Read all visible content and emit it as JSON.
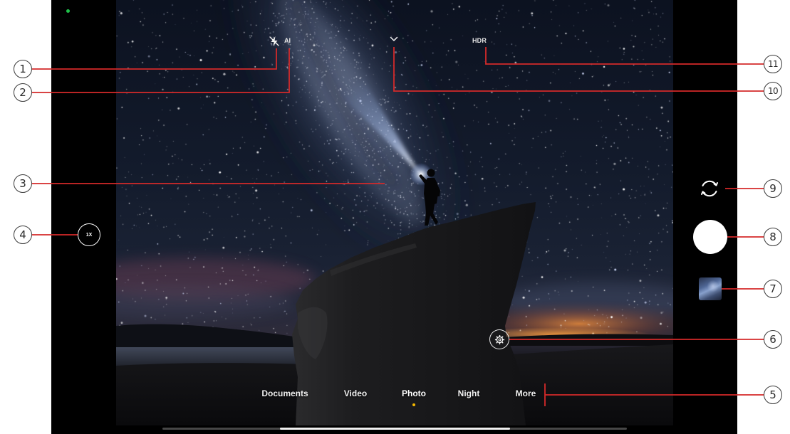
{
  "status": {
    "camera_indicator_color": "#1fc24a"
  },
  "top_bar": {
    "flash_icon": "flash-off-icon",
    "ai_label": "AI",
    "expand_icon": "chevron-down-icon",
    "hdr_label": "HDR"
  },
  "left_panel": {
    "zoom_label": "1X"
  },
  "right_panel": {
    "switch_camera_icon": "rotate-camera-icon"
  },
  "viewfinder": {
    "settings_icon": "settings-icon"
  },
  "modes": {
    "items": [
      {
        "label": "Documents",
        "active": false
      },
      {
        "label": "Video",
        "active": false
      },
      {
        "label": "Photo",
        "active": true
      },
      {
        "label": "Night",
        "active": false
      },
      {
        "label": "More",
        "active": false
      }
    ],
    "active_indicator_color": "#f5b800"
  },
  "callouts": {
    "line_color": "#d42a2a",
    "labels": [
      "1",
      "2",
      "3",
      "4",
      "5",
      "6",
      "7",
      "8",
      "9",
      "10",
      "11"
    ]
  },
  "colors": {
    "page_background": "#ffffff",
    "screen_background": "#000000"
  }
}
